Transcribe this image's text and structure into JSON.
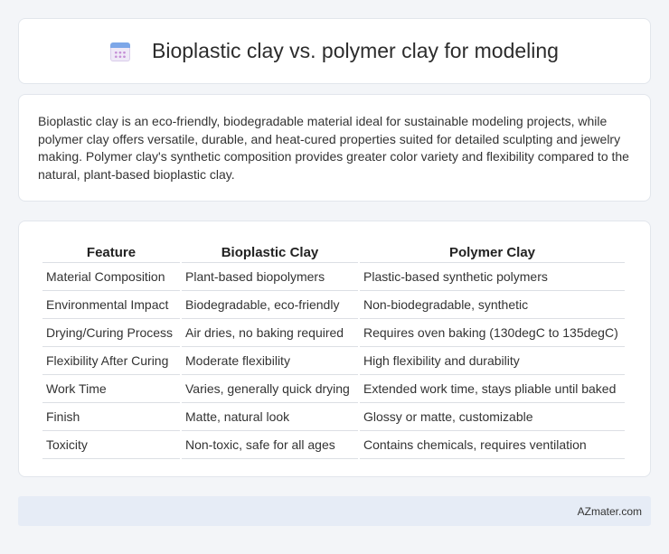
{
  "header": {
    "icon": "calendar-icon",
    "title": "Bioplastic clay vs. polymer clay for modeling"
  },
  "description": "Bioplastic clay is an eco-friendly, biodegradable material ideal for sustainable modeling projects, while polymer clay offers versatile, durable, and heat-cured properties suited for detailed sculpting and jewelry making. Polymer clay's synthetic composition provides greater color variety and flexibility compared to the natural, plant-based bioplastic clay.",
  "table": {
    "headers": [
      "Feature",
      "Bioplastic Clay",
      "Polymer Clay"
    ],
    "rows": [
      [
        "Material Composition",
        "Plant-based biopolymers",
        "Plastic-based synthetic polymers"
      ],
      [
        "Environmental Impact",
        "Biodegradable, eco-friendly",
        "Non-biodegradable, synthetic"
      ],
      [
        "Drying/Curing Process",
        "Air dries, no baking required",
        "Requires oven baking (130degC to 135degC)"
      ],
      [
        "Flexibility After Curing",
        "Moderate flexibility",
        "High flexibility and durability"
      ],
      [
        "Work Time",
        "Varies, generally quick drying",
        "Extended work time, stays pliable until baked"
      ],
      [
        "Finish",
        "Matte, natural look",
        "Glossy or matte, customizable"
      ],
      [
        "Toxicity",
        "Non-toxic, safe for all ages",
        "Contains chemicals, requires ventilation"
      ]
    ]
  },
  "footer": {
    "brand": "AZmater.com"
  },
  "colors": {
    "background": "#f3f5f8",
    "card": "#ffffff",
    "footer_bg": "#e6ecf6",
    "icon_accent": "#7da7e8"
  }
}
